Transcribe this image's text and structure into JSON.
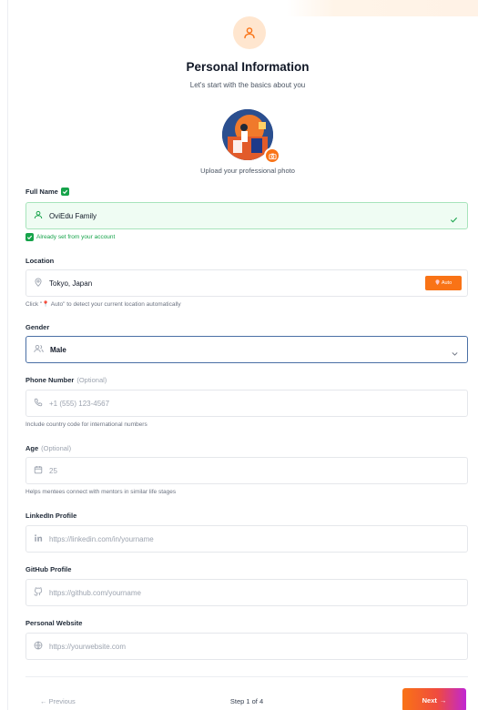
{
  "header": {
    "title": "Personal Information",
    "subtitle": "Let's start with the basics about you",
    "icon": "user-icon"
  },
  "photo": {
    "caption": "Upload your professional photo",
    "badge_icon": "camera-icon"
  },
  "fields": {
    "full_name": {
      "label": "Full Name",
      "value": "OviEdu Family",
      "icon": "user-icon",
      "note": "Already set from your account"
    },
    "location": {
      "label": "Location",
      "value": "Tokyo, Japan",
      "icon": "map-pin-icon",
      "auto_button": "Auto",
      "help": "Click \"📍 Auto\" to detect your current location automatically"
    },
    "gender": {
      "label": "Gender",
      "value": "Male",
      "icon": "users-icon"
    },
    "phone": {
      "label": "Phone Number",
      "optional": "(Optional)",
      "placeholder": "+1 (555) 123-4567",
      "icon": "phone-icon",
      "help": "Include country code for international numbers"
    },
    "age": {
      "label": "Age",
      "optional": "(Optional)",
      "placeholder": "25",
      "icon": "calendar-icon",
      "help": "Helps mentees connect with mentors in similar life stages"
    },
    "linkedin": {
      "label": "LinkedIn Profile",
      "placeholder": "https://linkedin.com/in/yourname",
      "icon": "linkedin-icon"
    },
    "github": {
      "label": "GitHub Profile",
      "placeholder": "https://github.com/yourname",
      "icon": "github-icon"
    },
    "website": {
      "label": "Personal Website",
      "placeholder": "https://yourwebsite.com",
      "icon": "globe-icon"
    }
  },
  "footer": {
    "prev_label": "Previous",
    "step_text": "Step 1 of 4",
    "next_label": "Next"
  },
  "colors": {
    "accent": "#f97316",
    "success": "#16a34a",
    "focus_border": "#4a6fa5"
  }
}
